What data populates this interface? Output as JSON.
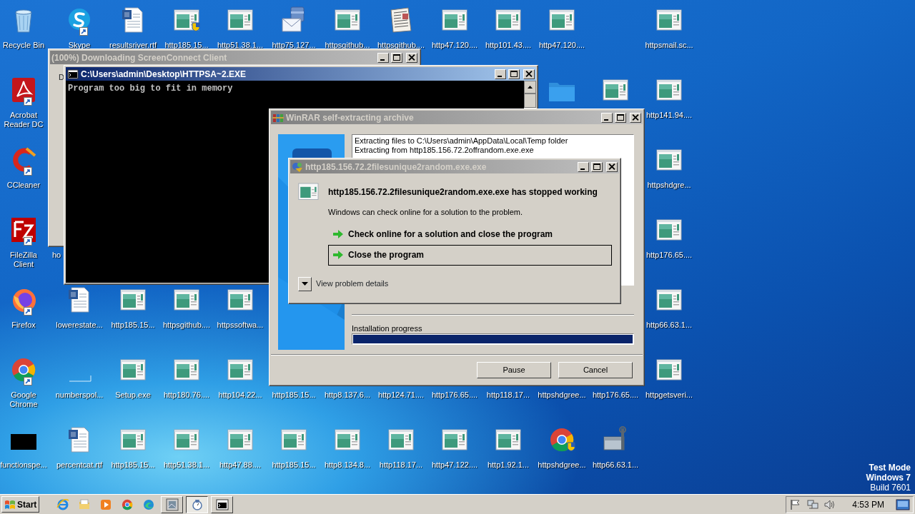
{
  "desktop_icons": [
    {
      "label": "Recycle Bin",
      "kind": "recycle-bin",
      "shortcut": false
    },
    {
      "label": "Skype",
      "kind": "skype",
      "shortcut": true
    },
    {
      "label": "resultsriver.rtf",
      "kind": "word-doc",
      "shortcut": false
    },
    {
      "label": "http185.15...",
      "kind": "app-shield",
      "shortcut": false
    },
    {
      "label": "http51.38.1...",
      "kind": "app",
      "shortcut": false
    },
    {
      "label": "http75.127...",
      "kind": "mail",
      "shortcut": false
    },
    {
      "label": "httpsgithub...",
      "kind": "app",
      "shortcut": false
    },
    {
      "label": "httpsgithub....",
      "kind": "newspaper",
      "shortcut": false
    },
    {
      "label": "http47.120....",
      "kind": "app",
      "shortcut": false
    },
    {
      "label": "http101.43....",
      "kind": "app",
      "shortcut": false
    },
    {
      "label": "http47.120....",
      "kind": "app",
      "shortcut": false
    },
    {
      "label": "httpsmail.sc...",
      "kind": "app",
      "shortcut": false
    },
    {
      "label": "Acrobat Reader DC",
      "kind": "acrobat",
      "shortcut": true
    },
    {
      "kind": "folder",
      "shortcut": false
    },
    {
      "kind": "app",
      "shortcut": false
    },
    {
      "label": "http141.94....",
      "kind": "app",
      "shortcut": false
    },
    {
      "label": "CCleaner",
      "kind": "ccleaner",
      "shortcut": true
    },
    {
      "label": "httpshdgre...",
      "kind": "app",
      "shortcut": false
    },
    {
      "label": "FileZilla Client",
      "kind": "filezilla",
      "shortcut": true
    },
    {
      "label": "ho",
      "kind": "partial",
      "shortcut": false
    },
    {
      "label": "http176.65....",
      "kind": "app",
      "shortcut": false
    },
    {
      "label": "Firefox",
      "kind": "firefox",
      "shortcut": true
    },
    {
      "label": "lowerestate...",
      "kind": "word-doc",
      "shortcut": false
    },
    {
      "label": "http185.15...",
      "kind": "app",
      "shortcut": false
    },
    {
      "label": "httpsgithub....",
      "kind": "app",
      "shortcut": false
    },
    {
      "label": "httpssoftwa...",
      "kind": "app",
      "shortcut": false
    },
    {
      "label": "http66.63.1...",
      "kind": "app",
      "shortcut": false
    },
    {
      "label": "Google Chrome",
      "kind": "chrome",
      "shortcut": true
    },
    {
      "label": "numberspol...",
      "kind": "blank",
      "shortcut": false
    },
    {
      "label": "Setup.exe",
      "kind": "app",
      "shortcut": false
    },
    {
      "label": "http180.76....",
      "kind": "app",
      "shortcut": false
    },
    {
      "label": "http104.22...",
      "kind": "app",
      "shortcut": false
    },
    {
      "label": "http185.15...",
      "kind": "covered",
      "shortcut": false
    },
    {
      "label": "http8.137.6...",
      "kind": "covered",
      "shortcut": false
    },
    {
      "label": "http124.71....",
      "kind": "covered",
      "shortcut": false
    },
    {
      "label": "http176.65....",
      "kind": "covered",
      "shortcut": false
    },
    {
      "label": "http118.17...",
      "kind": "covered",
      "shortcut": false
    },
    {
      "label": "httpshdgree...",
      "kind": "covered",
      "shortcut": false
    },
    {
      "label": "http176.65....",
      "kind": "covered",
      "shortcut": false
    },
    {
      "label": "httpgetsveri...",
      "kind": "app",
      "shortcut": false
    },
    {
      "label": "functionspe...",
      "kind": "black-rect",
      "shortcut": false
    },
    {
      "label": "percentcat.rtf",
      "kind": "word-doc",
      "shortcut": false
    },
    {
      "label": "http185.15...",
      "kind": "app",
      "shortcut": false
    },
    {
      "label": "http51.38.1...",
      "kind": "app",
      "shortcut": false
    },
    {
      "label": "http47.88....",
      "kind": "app",
      "shortcut": false
    },
    {
      "label": "http185.15...",
      "kind": "app",
      "shortcut": false
    },
    {
      "label": "http8.134.8...",
      "kind": "app",
      "shortcut": false
    },
    {
      "label": "http118.17...",
      "kind": "app",
      "shortcut": false
    },
    {
      "label": "http47.122....",
      "kind": "app",
      "shortcut": false
    },
    {
      "label": "http1.92.1...",
      "kind": "app",
      "shortcut": false
    },
    {
      "label": "httpshdgree...",
      "kind": "chrome-shield",
      "shortcut": false
    },
    {
      "label": "http66.63.1...",
      "kind": "toolbox",
      "shortcut": false
    }
  ],
  "screenconnect_window": {
    "title": "(100%) Downloading ScreenConnect Client",
    "active": false,
    "body_text": "D"
  },
  "console_window": {
    "title": "C:\\Users\\admin\\Desktop\\HTTPSA~2.EXE",
    "active": true,
    "output": "Program too big to fit in memory"
  },
  "winrar_window": {
    "title": "WinRAR self-extracting archive",
    "active": false,
    "log": [
      "Extracting files to C:\\Users\\admin\\AppData\\Local\\Temp folder",
      "Extracting from http185.156.72.2offrandom.exe.exe"
    ],
    "progress_label": "Installation progress",
    "progress": {
      "level": 1
    },
    "buttons": [
      "Pause",
      "Cancel"
    ]
  },
  "error_dialog": {
    "title": "http185.156.72.2filesunique2random.exe.exe",
    "active": false,
    "heading": "http185.156.72.2filesunique2random.exe.exe has stopped working",
    "message": "Windows can check online for a solution to the problem.",
    "options": [
      {
        "label": "Check online for a solution and close the program",
        "selected": false
      },
      {
        "label": "Close the program",
        "selected": true
      }
    ],
    "details": {
      "label": "View problem details",
      "expanded": false
    }
  },
  "taskbar": {
    "start_label": "Start",
    "quick_launch": [
      {
        "kind": "ie"
      },
      {
        "kind": "explorer"
      },
      {
        "kind": "media"
      },
      {
        "kind": "chrome"
      },
      {
        "kind": "edge"
      }
    ],
    "tasks": [
      {
        "kind": "archive",
        "selected": false
      },
      {
        "kind": "error-report",
        "selected": true
      },
      {
        "kind": "console",
        "selected": false
      }
    ],
    "tray_icons": [
      {
        "kind": "flag"
      },
      {
        "kind": "network"
      },
      {
        "kind": "speaker"
      }
    ],
    "clock": "4:53 PM"
  },
  "os_notice": [
    "Test Mode",
    "Windows 7",
    "Build 7601"
  ]
}
